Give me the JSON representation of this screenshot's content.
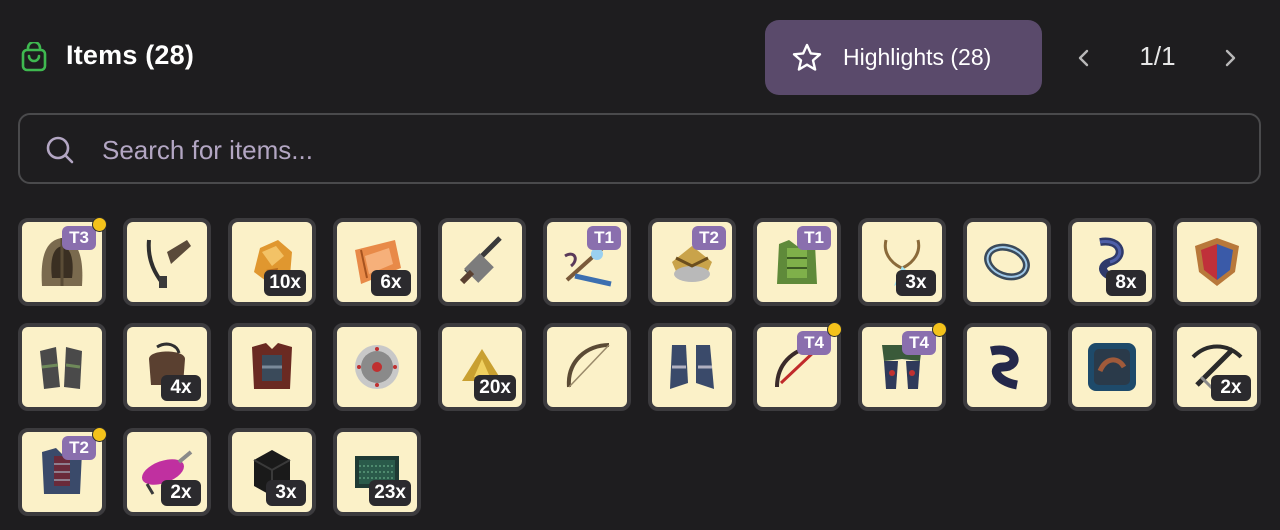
{
  "header": {
    "title": "Items (28)",
    "highlights_label": "Highlights (28)",
    "page_indicator": "1/1",
    "accent_color": "#3fb950",
    "highlight_bg": "#5a4a6b"
  },
  "search": {
    "placeholder": "Search for items..."
  },
  "items": [
    {
      "icon": "hood-icon",
      "tier": "T3",
      "qty": "",
      "new": true
    },
    {
      "icon": "sling-icon",
      "tier": "",
      "qty": "",
      "new": false
    },
    {
      "icon": "ore-icon",
      "tier": "",
      "qty": "10x",
      "new": false
    },
    {
      "icon": "hide-icon",
      "tier": "",
      "qty": "6x",
      "new": false
    },
    {
      "icon": "crossbow-icon",
      "tier": "",
      "qty": "",
      "new": false
    },
    {
      "icon": "staff-icon",
      "tier": "T1",
      "qty": "",
      "new": false
    },
    {
      "icon": "helm-icon",
      "tier": "T2",
      "qty": "",
      "new": false
    },
    {
      "icon": "armor-icon",
      "tier": "T1",
      "qty": "",
      "new": false
    },
    {
      "icon": "amulet-icon",
      "tier": "",
      "qty": "3x",
      "new": false
    },
    {
      "icon": "ring-icon",
      "tier": "",
      "qty": "",
      "new": false
    },
    {
      "icon": "cloth-icon",
      "tier": "",
      "qty": "8x",
      "new": false
    },
    {
      "icon": "shield-icon",
      "tier": "",
      "qty": "",
      "new": false
    },
    {
      "icon": "gauntlets-icon",
      "tier": "",
      "qty": "",
      "new": false
    },
    {
      "icon": "pouch-icon",
      "tier": "",
      "qty": "4x",
      "new": false
    },
    {
      "icon": "chestplate-icon",
      "tier": "",
      "qty": "",
      "new": false
    },
    {
      "icon": "round-shield-icon",
      "tier": "",
      "qty": "",
      "new": false
    },
    {
      "icon": "gold-icon",
      "tier": "",
      "qty": "20x",
      "new": false
    },
    {
      "icon": "bow-icon",
      "tier": "",
      "qty": "",
      "new": false
    },
    {
      "icon": "boots-icon",
      "tier": "",
      "qty": "",
      "new": false
    },
    {
      "icon": "red-bow-icon",
      "tier": "T4",
      "qty": "",
      "new": true
    },
    {
      "icon": "legguards-icon",
      "tier": "T4",
      "qty": "",
      "new": true
    },
    {
      "icon": "scarf-icon",
      "tier": "",
      "qty": "",
      "new": false
    },
    {
      "icon": "spellbook-icon",
      "tier": "",
      "qty": "",
      "new": false
    },
    {
      "icon": "dark-crossbow-icon",
      "tier": "",
      "qty": "2x",
      "new": false
    },
    {
      "icon": "chainmail-icon",
      "tier": "T2",
      "qty": "",
      "new": true
    },
    {
      "icon": "potion-icon",
      "tier": "",
      "qty": "2x",
      "new": false
    },
    {
      "icon": "cube-icon",
      "tier": "",
      "qty": "3x",
      "new": false
    },
    {
      "icon": "mat-icon",
      "tier": "",
      "qty": "23x",
      "new": false
    }
  ]
}
